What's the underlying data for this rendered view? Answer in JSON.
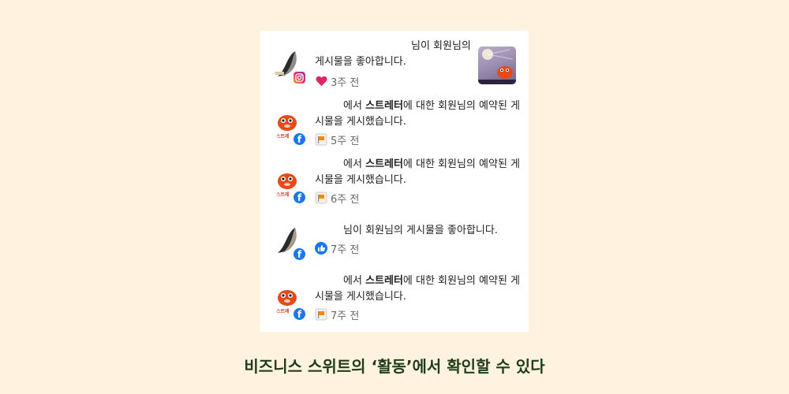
{
  "notifications": [
    {
      "platform": "instagram",
      "text_parts": [
        "님이 회원님의",
        "게시물을 좋아합니다."
      ],
      "reaction_icon": "heart-icon",
      "time": "3주 전",
      "has_thumbnail": true
    },
    {
      "platform": "facebook",
      "prefix": "에서 ",
      "strong": "스트레터",
      "suffix": "에 대한 회원님의 예약된 게시물을 게시했습니다.",
      "reaction_icon": "flag-icon",
      "time": "5주 전"
    },
    {
      "platform": "facebook",
      "prefix": "에서 ",
      "strong": "스트레터",
      "suffix": "에 대한 회원님의 예약된 게시물을 게시했습니다.",
      "reaction_icon": "flag-icon",
      "time": "6주 전"
    },
    {
      "platform": "facebook",
      "text": "님이 회원님의 게시물을 좋아합니다.",
      "reaction_icon": "like-icon",
      "time": "7주 전"
    },
    {
      "platform": "facebook",
      "prefix": "에서 ",
      "strong": "스트레터",
      "suffix": "에 대한 회원님의 예약된 게시물을 게시했습니다.",
      "reaction_icon": "flag-icon",
      "time": "7주 전"
    }
  ],
  "avatar_label": "스트레",
  "caption": "비즈니스 스위트의 ‘활동’에서 확인할 수 있다",
  "colors": {
    "background": "#FFF3E0",
    "caption": "#1f3d17",
    "facebook": "#1877F2",
    "heart": "#e0245e",
    "meta": "#65676b"
  }
}
